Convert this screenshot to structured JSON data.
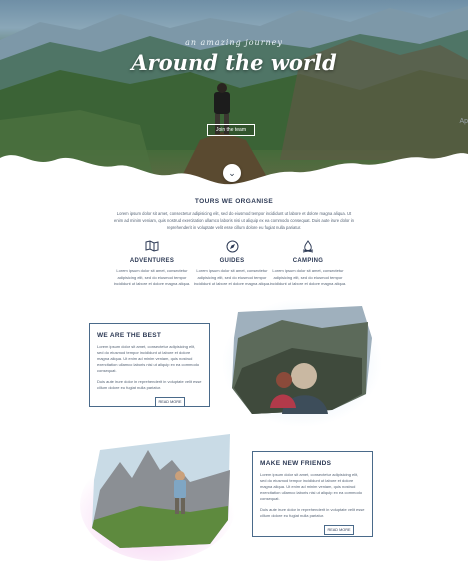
{
  "hero": {
    "subtitle": "an amazing journey",
    "title": "Around the world",
    "button_label": "Join the team",
    "side_tab_label": "Ap",
    "scroll_icon": "chevron-down-icon"
  },
  "tours": {
    "title": "TOURS WE ORGANISE",
    "text": "Lorem ipsum dolor sit amet, consectetur adipisicing elit, sed do eiusmod tempor incididunt ut labore et dolore magna aliqua. Ut enim ad minim veniam, quis nostrud exercitation ullamco laboris nisi ut aliquip ex ea commodo consequat. Duis aute irure dolor in reprehenderit in voluptate velit esse cillum dolore eu fugiat nulla pariatur.",
    "features": [
      {
        "icon": "map-icon",
        "label": "ADVENTURES",
        "text": "Lorem ipsum dolor sit amet, consectetur adipisicing elit, sed do eiusmod tempor incididunt ut labore et dolore magna aliqua."
      },
      {
        "icon": "compass-icon",
        "label": "GUIDES",
        "text": "Lorem ipsum dolor sit amet, consectetur adipisicing elit, sed do eiusmod tempor incididunt ut labore et dolore magna aliqua."
      },
      {
        "icon": "campfire-icon",
        "label": "CAMPING",
        "text": "Lorem ipsum dolor sit amet, consectetur adipisicing elit, sed do eiusmod tempor incididunt ut labore et dolore magna aliqua."
      }
    ]
  },
  "best": {
    "title": "WE ARE THE BEST",
    "para1": "Lorem ipsum dolor sit amet, consectetur adipisicing elit, sed do eiusmod tempor incididunt ut labore et dolore magna aliqua. Ut enim ad minim veniam, quis nostrud exercitation ullamco laboris nisi ut aliquip ex ea commodo consequat.",
    "para2": "Duis aute irure dolor in reprehenderit in voluptate velit esse cillum dolore eu fugiat nulla pariatur.",
    "button_label": "READ MORE"
  },
  "friends": {
    "title": "MAKE NEW FRIENDS",
    "para1": "Lorem ipsum dolor sit amet, consectetur adipisicing elit, sed do eiusmod tempor incididunt ut labore et dolore magna aliqua. Ut enim ad minim veniam, quis nostrud exercitation ullamco laboris nisi ut aliquip ex ea commodo consequat.",
    "para2": "Duis aute irure dolor in reprehenderit in voluptate velit esse cillum dolore eu fugiat nulla pariatur.",
    "button_label": "READ MORE"
  },
  "colors": {
    "accent": "#2d3a55",
    "card_border": "#4a6a8a",
    "glow_blue": "#cfe3f7",
    "glow_pink": "#f3c6ee"
  }
}
